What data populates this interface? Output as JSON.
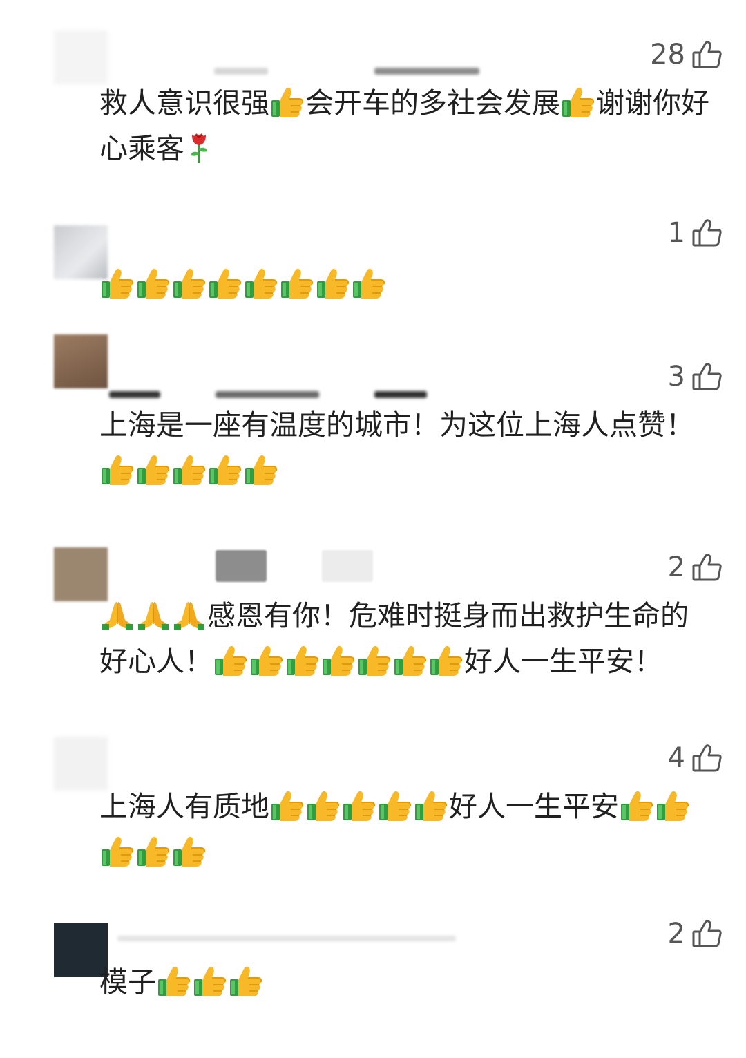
{
  "comments": [
    {
      "likes": "28",
      "parts": [
        {
          "t": "text",
          "v": "救人意识很强"
        },
        {
          "t": "icon",
          "v": "thumbs-up"
        },
        {
          "t": "text",
          "v": "会开车的多社会发展"
        },
        {
          "t": "icon",
          "v": "thumbs-up"
        },
        {
          "t": "text",
          "v": "谢谢你好心乘客"
        },
        {
          "t": "icon",
          "v": "rose"
        }
      ]
    },
    {
      "likes": "1",
      "parts": [
        {
          "t": "icon",
          "v": "thumbs-up"
        },
        {
          "t": "icon",
          "v": "thumbs-up"
        },
        {
          "t": "icon",
          "v": "thumbs-up"
        },
        {
          "t": "icon",
          "v": "thumbs-up"
        },
        {
          "t": "icon",
          "v": "thumbs-up"
        },
        {
          "t": "icon",
          "v": "thumbs-up"
        },
        {
          "t": "icon",
          "v": "thumbs-up"
        },
        {
          "t": "icon",
          "v": "thumbs-up"
        }
      ]
    },
    {
      "likes": "3",
      "parts": [
        {
          "t": "text",
          "v": "上海是一座有温度的城市！为这位上海人点赞！"
        },
        {
          "t": "icon",
          "v": "thumbs-up"
        },
        {
          "t": "icon",
          "v": "thumbs-up"
        },
        {
          "t": "icon",
          "v": "thumbs-up"
        },
        {
          "t": "icon",
          "v": "thumbs-up"
        },
        {
          "t": "icon",
          "v": "thumbs-up"
        }
      ]
    },
    {
      "likes": "2",
      "parts": [
        {
          "t": "icon",
          "v": "praying-hands"
        },
        {
          "t": "icon",
          "v": "praying-hands"
        },
        {
          "t": "icon",
          "v": "praying-hands"
        },
        {
          "t": "text",
          "v": "感恩有你！危难时挺身而出救护生命的好心人！"
        },
        {
          "t": "icon",
          "v": "thumbs-up"
        },
        {
          "t": "icon",
          "v": "thumbs-up"
        },
        {
          "t": "icon",
          "v": "thumbs-up"
        },
        {
          "t": "icon",
          "v": "thumbs-up"
        },
        {
          "t": "icon",
          "v": "thumbs-up"
        },
        {
          "t": "icon",
          "v": "thumbs-up"
        },
        {
          "t": "icon",
          "v": "thumbs-up"
        },
        {
          "t": "text",
          "v": "好人一生平安！"
        }
      ]
    },
    {
      "likes": "4",
      "parts": [
        {
          "t": "text",
          "v": "上海人有质地"
        },
        {
          "t": "icon",
          "v": "thumbs-up"
        },
        {
          "t": "icon",
          "v": "thumbs-up"
        },
        {
          "t": "icon",
          "v": "thumbs-up"
        },
        {
          "t": "icon",
          "v": "thumbs-up"
        },
        {
          "t": "icon",
          "v": "thumbs-up"
        },
        {
          "t": "text",
          "v": "好人一生平安"
        },
        {
          "t": "icon",
          "v": "thumbs-up"
        },
        {
          "t": "icon",
          "v": "thumbs-up"
        },
        {
          "t": "icon",
          "v": "thumbs-up"
        },
        {
          "t": "icon",
          "v": "thumbs-up"
        },
        {
          "t": "icon",
          "v": "thumbs-up"
        }
      ]
    },
    {
      "likes": "2",
      "parts": [
        {
          "t": "text",
          "v": "模子"
        },
        {
          "t": "icon",
          "v": "thumbs-up"
        },
        {
          "t": "icon",
          "v": "thumbs-up"
        },
        {
          "t": "icon",
          "v": "thumbs-up"
        }
      ]
    }
  ],
  "colors": {
    "avatar_1": "#f4f4f4",
    "avatar_2": "#d8dadc",
    "avatar_3": "#8a6a52",
    "avatar_4": "#9b8670",
    "avatar_5": "#f2f2f2",
    "avatar_6": "#1f2a33",
    "like_text": "#555555"
  }
}
